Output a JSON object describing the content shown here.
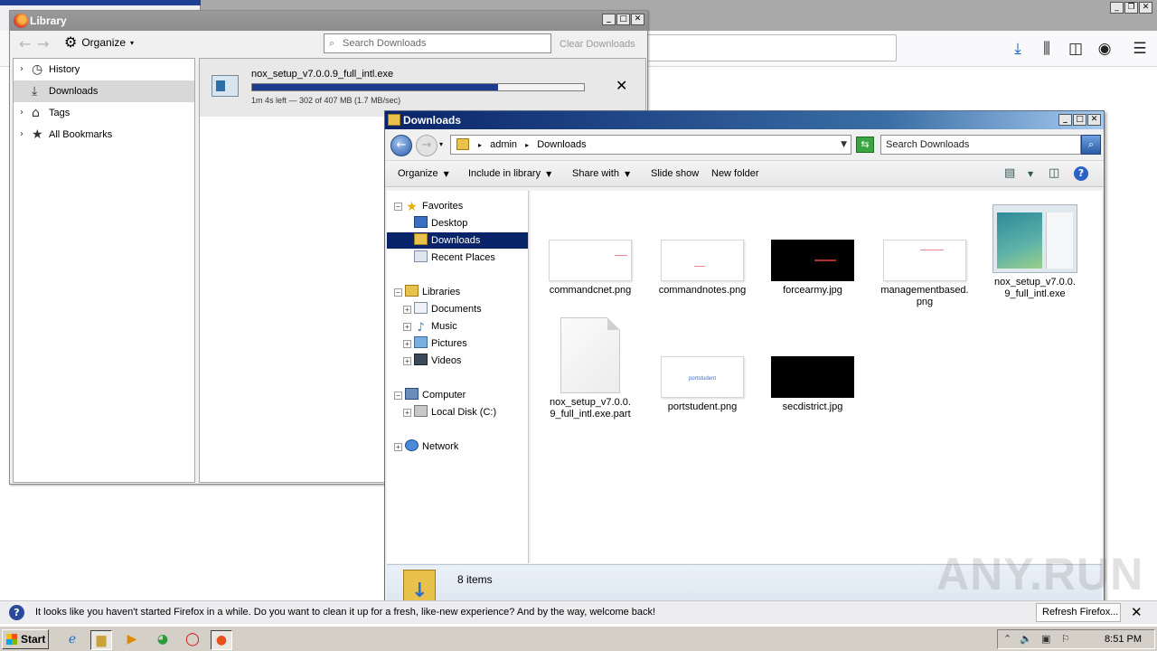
{
  "firefox": {
    "icons": [
      "download-icon",
      "library-icon",
      "sidebar-icon",
      "account-icon",
      "menu-icon"
    ]
  },
  "library": {
    "title": "Library",
    "organize_label": "Organize",
    "search_placeholder": "Search Downloads",
    "clear_label": "Clear Downloads",
    "sidebar": [
      {
        "label": "History",
        "icon": "clock-icon",
        "expandable": true
      },
      {
        "label": "Downloads",
        "icon": "download-icon",
        "expandable": false,
        "selected": true
      },
      {
        "label": "Tags",
        "icon": "tag-icon",
        "expandable": true
      },
      {
        "label": "All Bookmarks",
        "icon": "star-icon",
        "expandable": true
      }
    ],
    "download": {
      "filename": "nox_setup_v7.0.0.9_full_intl.exe",
      "status": "1m 4s left — 302 of 407 MB (1.7 MB/sec)",
      "progress_percent": 74
    }
  },
  "explorer": {
    "title": "Downloads",
    "breadcrumb": [
      "admin",
      "Downloads"
    ],
    "search_placeholder": "Search Downloads",
    "commands": [
      "Organize",
      "Include in library",
      "Share with",
      "Slide show",
      "New folder"
    ],
    "tree": {
      "favorites": "Favorites",
      "desktop": "Desktop",
      "downloads": "Downloads",
      "recent": "Recent Places",
      "libraries": "Libraries",
      "documents": "Documents",
      "music": "Music",
      "pictures": "Pictures",
      "videos": "Videos",
      "computer": "Computer",
      "localdisk": "Local Disk (C:)",
      "network": "Network"
    },
    "files": [
      {
        "name": "commandcnet.png"
      },
      {
        "name": "commandnotes.png"
      },
      {
        "name": "forcearmy.jpg"
      },
      {
        "name": "managementbased.\npng"
      },
      {
        "name": "nox_setup_v7.0.0.\n9_full_intl.exe"
      },
      {
        "name": "nox_setup_v7.0.0.\n9_full_intl.exe.part"
      },
      {
        "name": "portstudent.png",
        "thumb_text": "portstudent"
      },
      {
        "name": "secdistrict.jpg"
      }
    ],
    "item_count": "8 items"
  },
  "notification": {
    "text": "It looks like you haven't started Firefox in a while. Do you want to clean it up for a fresh, like-new experience? And by the way, welcome back!",
    "button": "Refresh Firefox..."
  },
  "taskbar": {
    "start_label": "Start",
    "clock": "8:51 PM"
  },
  "watermark": "ANY.RUN"
}
